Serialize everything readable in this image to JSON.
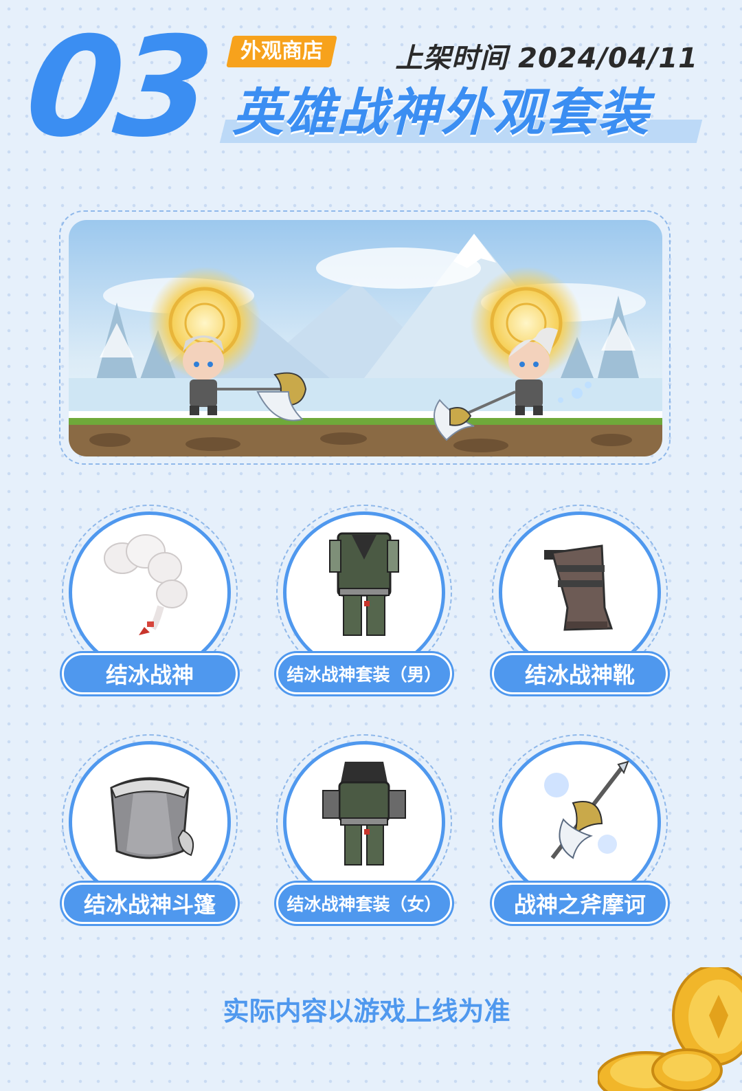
{
  "header": {
    "section_number": "03",
    "tag": "外观商店",
    "release_time": "上架时间 2024/04/11",
    "title": "英雄战神外观套装"
  },
  "items": [
    {
      "label": "结冰战神",
      "icon": "snow-cloud-icon"
    },
    {
      "label": "结冰战神套装（男）",
      "icon": "male-outfit-icon"
    },
    {
      "label": "结冰战神靴",
      "icon": "boots-icon"
    },
    {
      "label": "结冰战神斗篷",
      "icon": "cape-icon"
    },
    {
      "label": "结冰战神套装（女）",
      "icon": "female-outfit-icon"
    },
    {
      "label": "战神之斧摩诃",
      "icon": "polearm-icon"
    }
  ],
  "footer": {
    "disclaimer": "实际内容以游戏上线为准"
  },
  "colors": {
    "accent_blue": "#3b8ef2",
    "pill_blue": "#4f98ee",
    "tag_orange": "#f7a21c",
    "background": "#e6f0fb"
  }
}
